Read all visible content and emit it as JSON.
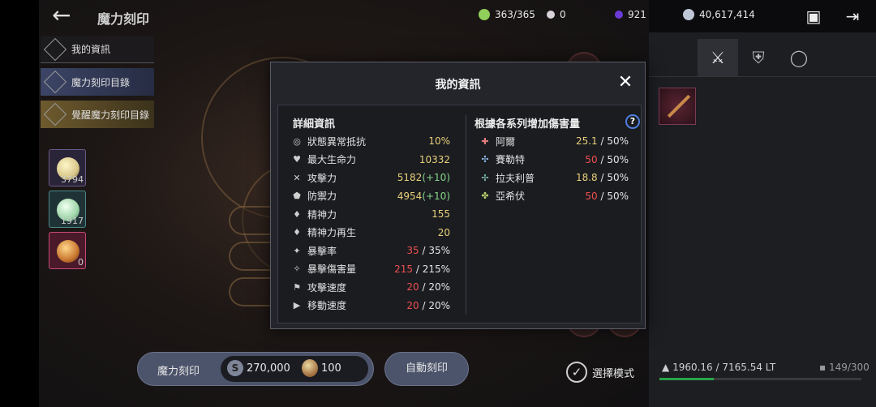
{
  "header": {
    "title": "魔力刻印",
    "resources": [
      {
        "name": "stamina",
        "value": "363/365",
        "color": "#8fcf5a"
      },
      {
        "name": "pearl",
        "value": "0",
        "color": "#d9d2d8"
      },
      {
        "name": "crystal",
        "value": "921",
        "color": "#6a3bd6"
      },
      {
        "name": "silver",
        "value": "40,617,414",
        "color": "#bfc6d6"
      }
    ]
  },
  "sidebar": {
    "items": [
      {
        "label": "我的資訊"
      },
      {
        "label": "魔力刻印目錄"
      },
      {
        "label": "覺醒魔力刻印目錄"
      }
    ],
    "inventory": [
      {
        "count": "3794",
        "color": "#d8c68a"
      },
      {
        "count": "1917",
        "color": "#9dd6a8"
      },
      {
        "count": "0",
        "color": "#c9782f"
      }
    ]
  },
  "modal": {
    "title": "我的資訊",
    "left_title": "詳細資訊",
    "right_title": "根據各系列增加傷害量",
    "help": "?",
    "stats": [
      {
        "icon": "◎",
        "label": "狀態異常抵抗",
        "value": "10%",
        "cls": "yel"
      },
      {
        "icon": "♥",
        "label": "最大生命力",
        "value": "10332",
        "cls": "yel"
      },
      {
        "icon": "✕",
        "label": "攻擊力",
        "value": "5182",
        "bonus": "(+10)",
        "cls": "yel"
      },
      {
        "icon": "⬟",
        "label": "防禦力",
        "value": "4954",
        "bonus": "(+10)",
        "cls": "yel"
      },
      {
        "icon": "♦",
        "label": "精神力",
        "value": "155",
        "cls": "yel"
      },
      {
        "icon": "♦",
        "label": "精神力再生",
        "value": "20",
        "cls": "yel"
      },
      {
        "icon": "✦",
        "label": "暴擊率",
        "value": "35",
        "max": " / 35%",
        "cls": "red"
      },
      {
        "icon": "✧",
        "label": "暴擊傷害量",
        "value": "215",
        "max": " / 215%",
        "cls": "red"
      },
      {
        "icon": "⚑",
        "label": "攻擊速度",
        "value": "20",
        "max": " / 20%",
        "cls": "red"
      },
      {
        "icon": "▶",
        "label": "移動速度",
        "value": "20",
        "max": " / 20%",
        "cls": "red"
      }
    ],
    "families": [
      {
        "icon": "✚",
        "label": "阿爾",
        "value": "25.1",
        "max": " / 50%",
        "cls": "yel",
        "color": "#e07a7a"
      },
      {
        "icon": "✣",
        "label": "賽勒特",
        "value": "50",
        "max": " / 50%",
        "cls": "red",
        "color": "#8fb8e8"
      },
      {
        "icon": "✢",
        "label": "拉夫利普",
        "value": "18.8",
        "max": " / 50%",
        "cls": "yel",
        "color": "#8ad0c0"
      },
      {
        "icon": "✤",
        "label": "亞希伏",
        "value": "50",
        "max": " / 50%",
        "cls": "red",
        "color": "#b7d06a"
      }
    ]
  },
  "bottom": {
    "inscribe_label": "魔力刻印",
    "cost_silver": "270,000",
    "cost_item": "100",
    "auto_label": "自動刻印",
    "select_mode_label": "選擇模式"
  },
  "right_panel": {
    "weight": "1960.16 / 7165.54 LT",
    "slots": "149/300",
    "weight_fraction": 0.27
  }
}
